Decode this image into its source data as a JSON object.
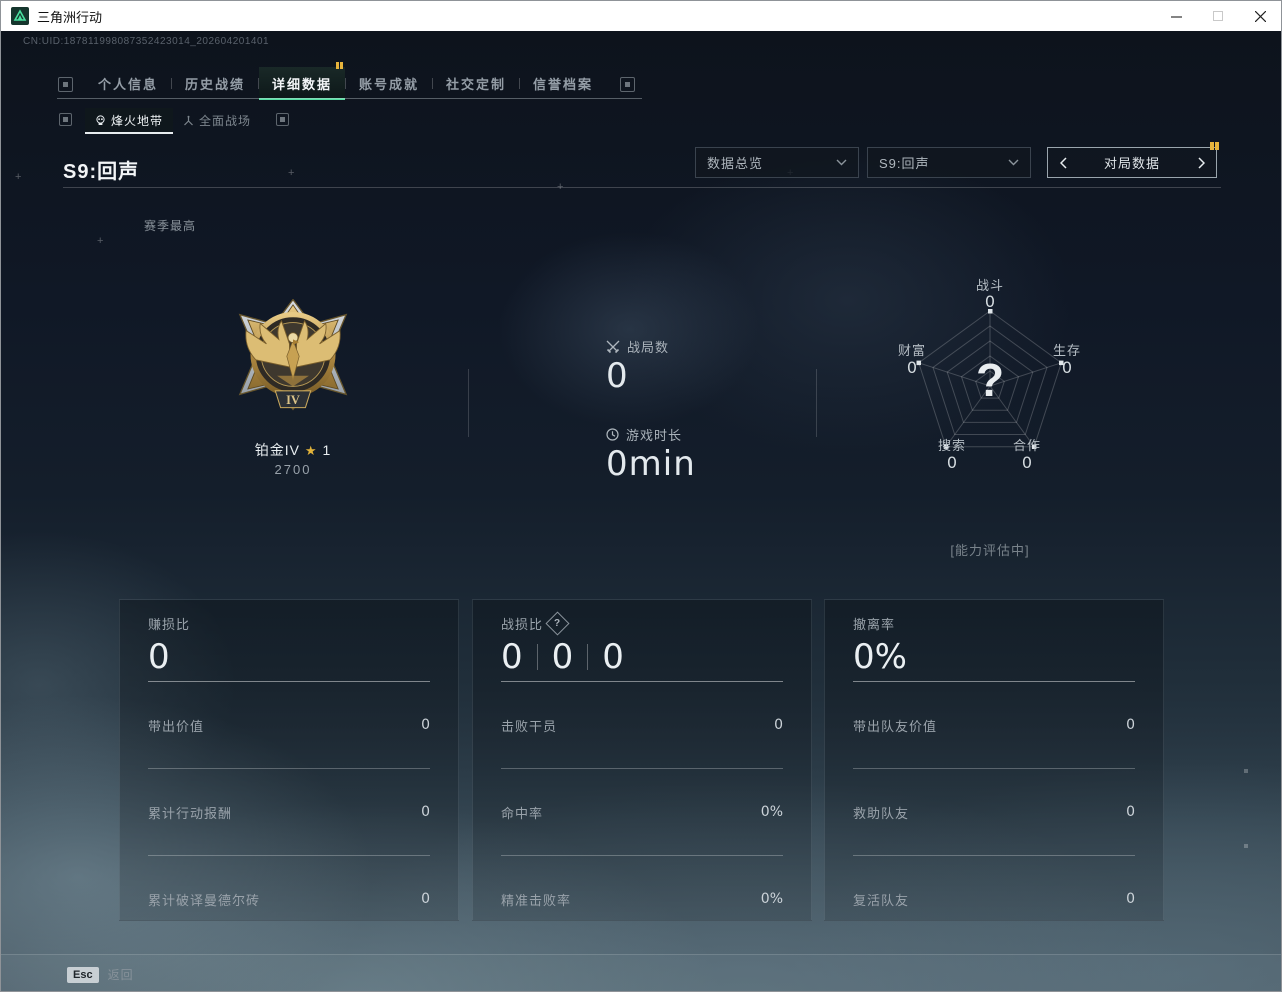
{
  "window": {
    "title": "三角洲行动",
    "controls": {
      "minimize": "minimize",
      "maximize": "maximize",
      "close": "close"
    }
  },
  "uid": "CN:UID:187811998087352423014_202604201401",
  "nav": {
    "tabs": [
      {
        "label": "个人信息"
      },
      {
        "label": "历史战绩"
      },
      {
        "label": "详细数据"
      },
      {
        "label": "账号成就"
      },
      {
        "label": "社交定制"
      },
      {
        "label": "信誉档案"
      }
    ],
    "active_index": 2
  },
  "mode_tabs": [
    {
      "label": "烽火地带",
      "icon": "skull-icon",
      "active": true
    },
    {
      "label": "全面战场",
      "icon": "battlefield-icon",
      "active": false
    }
  ],
  "section": {
    "title": "S9:回声",
    "season_best_label": "赛季最高",
    "filters": {
      "overview": "数据总览",
      "season": "S9:回声",
      "pager": "对局数据"
    }
  },
  "rank": {
    "name": "铂金IV",
    "star": "★",
    "star_count": "1",
    "score": "2700",
    "tier_numeral": "IV"
  },
  "summary": {
    "matches": {
      "label": "战局数",
      "value": "0",
      "icon": "crossed-swords-icon"
    },
    "playtime": {
      "label": "游戏时长",
      "value": "0min",
      "icon": "clock-icon"
    }
  },
  "evaluating_label": "[能力评估中]",
  "chart_data": {
    "type": "radar",
    "title": "能力评估雷达图",
    "categories": [
      "战斗",
      "生存",
      "合作",
      "搜索",
      "财富"
    ],
    "values": [
      0,
      0,
      0,
      0,
      0
    ],
    "value_labels": [
      "0",
      "0",
      "0",
      "0",
      "0"
    ],
    "center_text": "?",
    "levels": 5,
    "max": 100,
    "grid": true,
    "legend": "none"
  },
  "panels": [
    {
      "header": "赚损比",
      "value": "0",
      "rows": [
        {
          "label": "带出价值",
          "value": "0"
        },
        {
          "label": "累计行动报酬",
          "value": "0"
        },
        {
          "label": "累计破译曼德尔砖",
          "value": "0"
        }
      ]
    },
    {
      "header": "战损比",
      "help_icon": "question-icon",
      "help_text": "?",
      "values": [
        "0",
        "0",
        "0"
      ],
      "rows": [
        {
          "label": "击败干员",
          "value": "0"
        },
        {
          "label": "命中率",
          "value": "0%"
        },
        {
          "label": "精准击败率",
          "value": "0%"
        }
      ]
    },
    {
      "header": "撤离率",
      "value": "0%",
      "rows": [
        {
          "label": "带出队友价值",
          "value": "0"
        },
        {
          "label": "救助队友",
          "value": "0"
        },
        {
          "label": "复活队友",
          "value": "0"
        }
      ]
    }
  ],
  "footer": {
    "key": "Esc",
    "label": "返回"
  },
  "colors": {
    "accent_green": "#55dfa2",
    "notify_gold": "#e7b43c",
    "bg_dark": "#0e141d",
    "bg_mist": "#4a5b66",
    "medal_gold": "#d4b068",
    "star_gold": "#e2b33a"
  }
}
